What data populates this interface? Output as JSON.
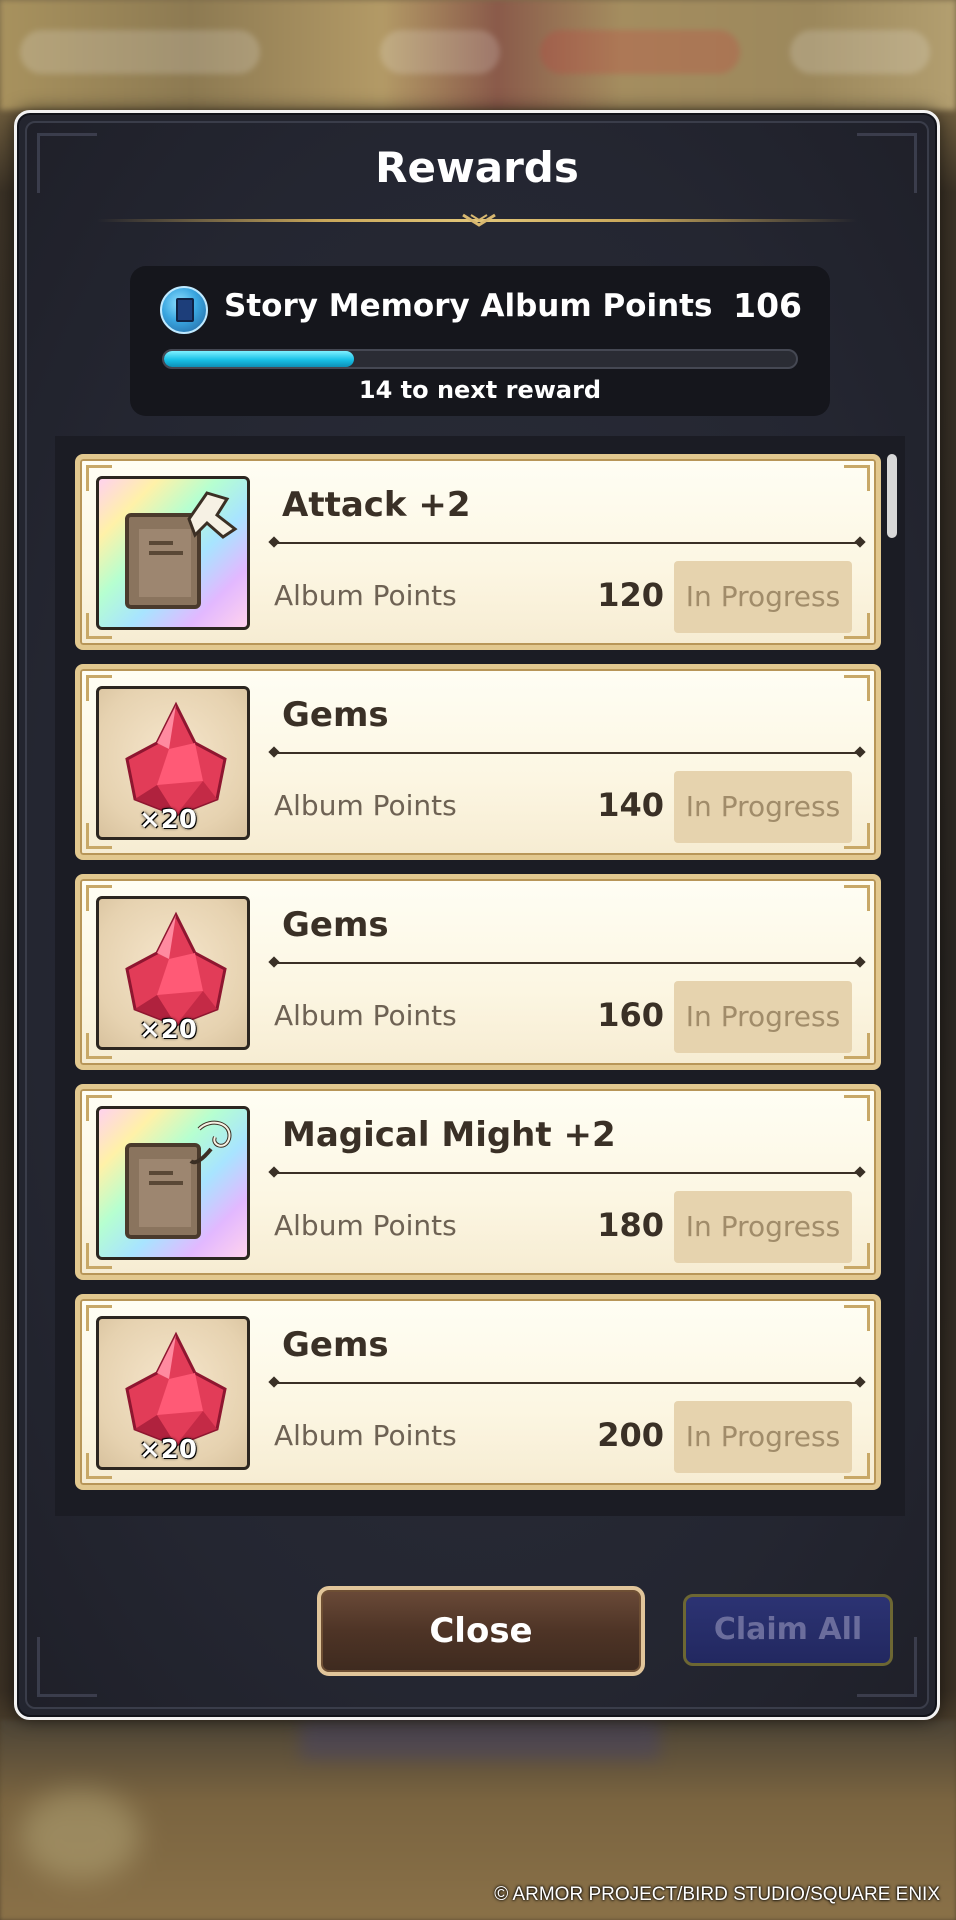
{
  "dialog": {
    "title": "Rewards"
  },
  "points": {
    "label": "Story Memory Album Points",
    "value": "106",
    "next_reward_text": "14 to next reward",
    "progress_fraction": 0.3
  },
  "rewards": [
    {
      "title": "Attack +2",
      "icon": "attack-book-icon",
      "quantity": "",
      "points_label": "Album Points",
      "points": "120",
      "status": "In Progress"
    },
    {
      "title": "Gems",
      "icon": "gem-icon",
      "quantity": "×20",
      "points_label": "Album Points",
      "points": "140",
      "status": "In Progress"
    },
    {
      "title": "Gems",
      "icon": "gem-icon",
      "quantity": "×20",
      "points_label": "Album Points",
      "points": "160",
      "status": "In Progress"
    },
    {
      "title": "Magical Might +2",
      "icon": "magic-book-icon",
      "quantity": "",
      "points_label": "Album Points",
      "points": "180",
      "status": "In Progress"
    },
    {
      "title": "Gems",
      "icon": "gem-icon",
      "quantity": "×20",
      "points_label": "Album Points",
      "points": "200",
      "status": "In Progress"
    }
  ],
  "buttons": {
    "close": "Close",
    "claim_all": "Claim All"
  },
  "footer": {
    "copyright": "© ARMOR PROJECT/BIRD STUDIO/SQUARE ENIX"
  },
  "colors": {
    "accent_bar": "#18c0e6",
    "card_bg": "#fcf6e2",
    "card_border": "#e2c88f",
    "dialog_bg": "#23252f",
    "claim_button": "#2c3373"
  }
}
